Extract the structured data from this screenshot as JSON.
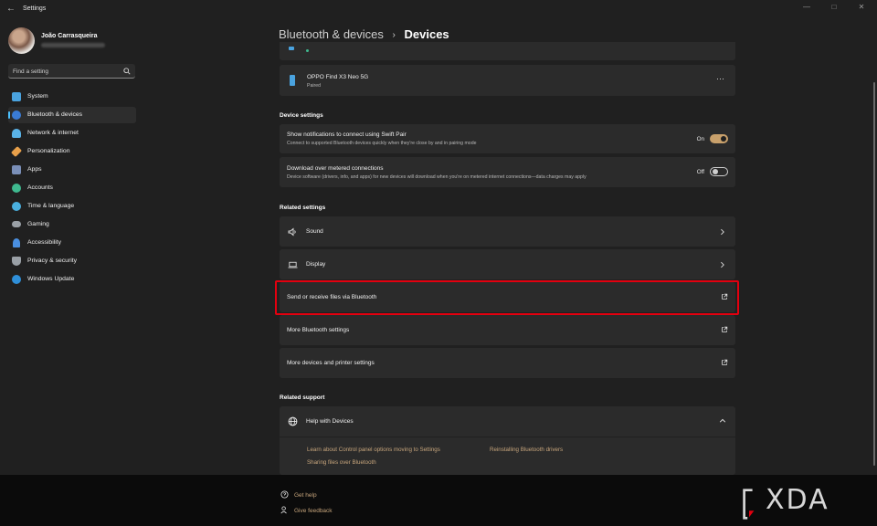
{
  "window": {
    "title": "Settings"
  },
  "profile": {
    "name": "João Carrasqueira"
  },
  "search": {
    "placeholder": "Find a setting"
  },
  "nav": {
    "items": [
      {
        "label": "System",
        "color": "#4aa3df"
      },
      {
        "label": "Bluetooth & devices",
        "color": "#3a7bd5",
        "active": true
      },
      {
        "label": "Network & internet",
        "color": "#5ab3e8"
      },
      {
        "label": "Personalization",
        "color": "#e8a04a"
      },
      {
        "label": "Apps",
        "color": "#7a8fb8"
      },
      {
        "label": "Accounts",
        "color": "#3fb98f"
      },
      {
        "label": "Time & language",
        "color": "#4ab0e0"
      },
      {
        "label": "Gaming",
        "color": "#9aa0a6"
      },
      {
        "label": "Accessibility",
        "color": "#4a8fe0"
      },
      {
        "label": "Privacy & security",
        "color": "#9aa0a6"
      },
      {
        "label": "Windows Update",
        "color": "#2f8fd8"
      }
    ]
  },
  "breadcrumb": {
    "parent": "Bluetooth & devices",
    "separator": "›",
    "current": "Devices"
  },
  "devices": {
    "oppo": {
      "name": "OPPO Find X3 Neo 5G",
      "status": "Paired",
      "more": "···"
    }
  },
  "device_settings": {
    "label": "Device settings",
    "swift_pair": {
      "title": "Show notifications to connect using Swift Pair",
      "subtitle": "Connect to supported Bluetooth devices quickly when they're close by and in pairing mode",
      "state": "On"
    },
    "metered": {
      "title": "Download over metered connections",
      "subtitle": "Device software (drivers, info, and apps) for new devices will download when you're on metered internet connections—data charges may apply",
      "state": "Off"
    }
  },
  "related_settings": {
    "label": "Related settings",
    "sound": "Sound",
    "display": "Display",
    "send_receive": "Send or receive files via Bluetooth",
    "more_bt": "More Bluetooth settings",
    "more_devices": "More devices and printer settings"
  },
  "related_support": {
    "label": "Related support",
    "help_title": "Help with Devices",
    "links": [
      "Learn about Control panel options moving to Settings",
      "Reinstalling Bluetooth drivers",
      "Sharing files over Bluetooth"
    ]
  },
  "footer": {
    "get_help": "Get help",
    "feedback": "Give feedback"
  },
  "watermark": {
    "text": "XDA"
  },
  "colors": {
    "accent": "#c8a06b",
    "highlight": "#e3000f",
    "active_indicator": "#4cc2ff"
  }
}
